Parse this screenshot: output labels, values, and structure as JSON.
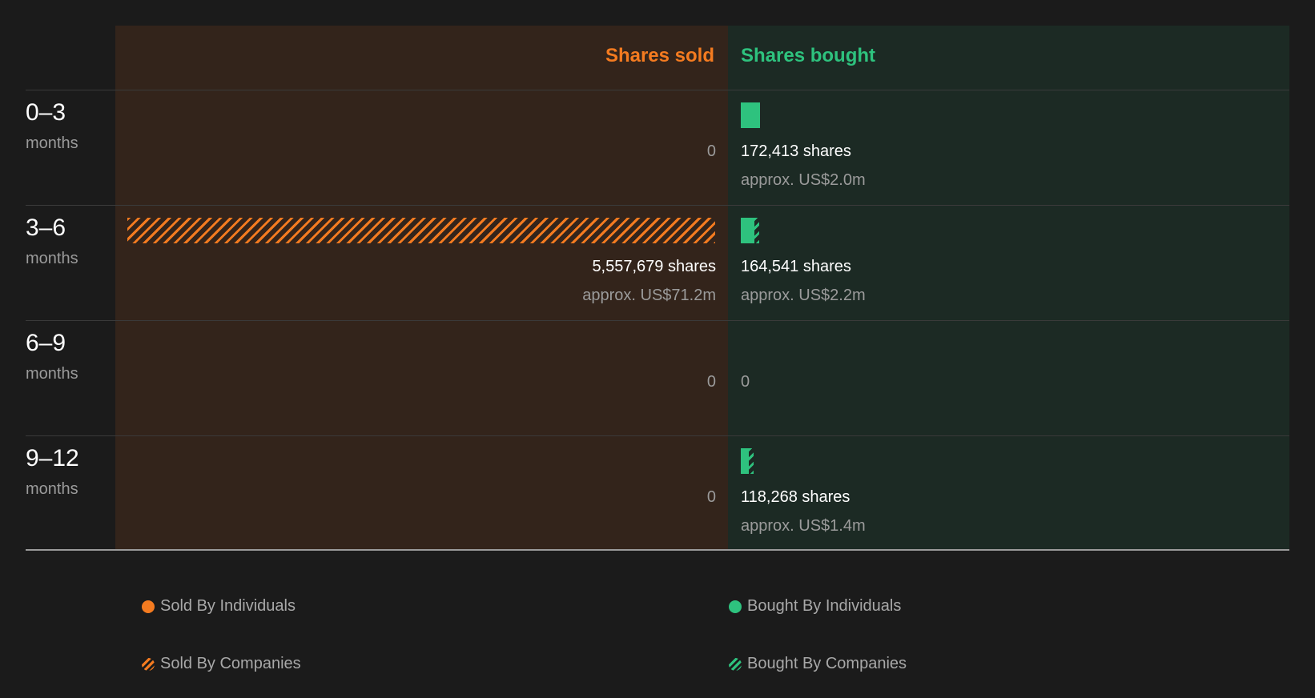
{
  "chart_data": {
    "type": "bar",
    "layout": "diverging-horizontal",
    "headers": {
      "sold": "Shares sold",
      "bought": "Shares bought"
    },
    "rows": [
      {
        "range": "0–3",
        "unit": "months",
        "sold": {
          "value": 0,
          "display": "0",
          "individuals": 0,
          "companies": 0
        },
        "bought": {
          "value": 172413,
          "display": "172,413 shares",
          "approx": "approx. US$2.0m",
          "individuals": 172413,
          "companies": 0
        }
      },
      {
        "range": "3–6",
        "unit": "months",
        "sold": {
          "value": 5557679,
          "display": "5,557,679 shares",
          "approx": "approx. US$71.2m",
          "individuals": 0,
          "companies": 5557679
        },
        "bought": {
          "value": 164541,
          "display": "164,541 shares",
          "approx": "approx. US$2.2m",
          "individuals": 125000,
          "companies": 39541
        }
      },
      {
        "range": "6–9",
        "unit": "months",
        "sold": {
          "value": 0,
          "display": "0",
          "individuals": 0,
          "companies": 0
        },
        "bought": {
          "value": 0,
          "display": "0",
          "individuals": 0,
          "companies": 0
        }
      },
      {
        "range": "9–12",
        "unit": "months",
        "sold": {
          "value": 0,
          "display": "0",
          "individuals": 0,
          "companies": 0
        },
        "bought": {
          "value": 118268,
          "display": "118,268 shares",
          "approx": "approx. US$1.4m",
          "individuals": 72000,
          "companies": 46268
        }
      }
    ],
    "legend": [
      {
        "label": "Sold By Individuals",
        "color": "#f47b20",
        "pattern": "solid"
      },
      {
        "label": "Bought By Individuals",
        "color": "#2ec27e",
        "pattern": "solid"
      },
      {
        "label": "Sold By Companies",
        "color": "#f47b20",
        "pattern": "hatched"
      },
      {
        "label": "Bought By Companies",
        "color": "#2ec27e",
        "pattern": "hatched"
      }
    ],
    "colors": {
      "sold": "#f47b20",
      "bought": "#2ec27e",
      "sold_bg": "#33241b",
      "bought_bg": "#1c2a24"
    },
    "max_value": 5557679
  }
}
